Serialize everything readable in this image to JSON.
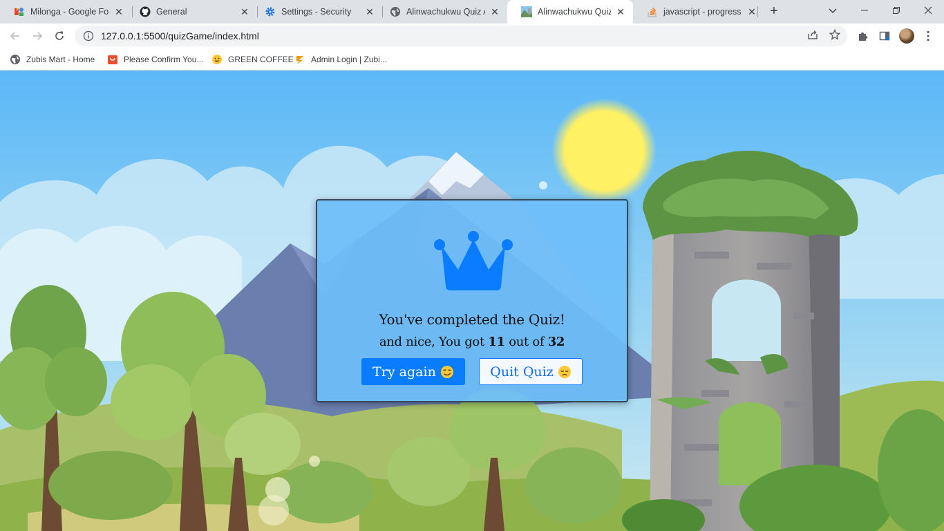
{
  "browser": {
    "tabs": [
      {
        "title": "Milonga - Google Fonts",
        "favicon": "google-fonts-icon",
        "active": false
      },
      {
        "title": "General",
        "favicon": "github-icon",
        "active": false
      },
      {
        "title": "Settings - Security",
        "favicon": "gear-icon",
        "active": false
      },
      {
        "title": "Alinwachukwu Quiz App",
        "favicon": "globe-icon",
        "active": false
      },
      {
        "title": "Alinwachukwu Quiz App",
        "favicon": "landscape-icon",
        "active": true
      },
      {
        "title": "javascript - progress bar",
        "favicon": "stackoverflow-icon",
        "active": false
      }
    ],
    "url": "127.0.0.1:5500/quizGame/index.html",
    "bookmarks": [
      {
        "label": "Zubis Mart - Home",
        "icon": "globe-icon"
      },
      {
        "label": "Please Confirm You...",
        "icon": "shopping-bag-icon"
      },
      {
        "label": "GREEN COFFEE",
        "icon": "smiley-icon"
      },
      {
        "label": "Admin Login | Zubi...",
        "icon": "zubi-icon"
      }
    ]
  },
  "quiz": {
    "completed_text": "You've completed the Quiz!",
    "score_prefix": "and nice, You got",
    "score": "11",
    "score_mid": "out of",
    "total": "32",
    "try_again_label": "Try again",
    "quit_label": "Quit Quiz"
  },
  "colors": {
    "accent": "#0a7cff",
    "modal_bg": "#6ebefa",
    "sky_top": "#5bb8f7"
  }
}
